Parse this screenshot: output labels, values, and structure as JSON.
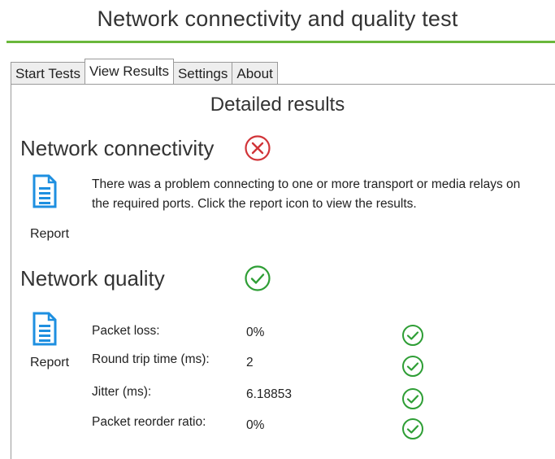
{
  "app": {
    "title": "Network connectivity and quality test"
  },
  "colors": {
    "accent_green": "#6ab83b",
    "error_red": "#d13438",
    "ok_green": "#2e9e35",
    "doc_blue": "#1e8fe0"
  },
  "tabs": [
    {
      "label": "Start Tests",
      "active": false
    },
    {
      "label": "View Results",
      "active": true
    },
    {
      "label": "Settings",
      "active": false
    },
    {
      "label": "About",
      "active": false
    }
  ],
  "results": {
    "heading": "Detailed results",
    "connectivity": {
      "title": "Network connectivity",
      "status_icon": "error-x-circle-icon",
      "report_icon": "document-icon",
      "report_label": "Report",
      "message": "There was a problem connecting to one or more transport or media relays on the required ports. Click the report icon to view the results."
    },
    "quality": {
      "title": "Network quality",
      "status_icon": "check-circle-icon",
      "report_icon": "document-icon",
      "report_label": "Report",
      "metrics": [
        {
          "label": "Packet loss:",
          "value": "0%",
          "status_icon": "check-circle-icon"
        },
        {
          "label": "Round trip time (ms):",
          "value": "2",
          "status_icon": "check-circle-icon"
        },
        {
          "label": "Jitter (ms):",
          "value": "6.18853",
          "status_icon": "check-circle-icon"
        },
        {
          "label": "Packet reorder ratio:",
          "value": "0%",
          "status_icon": "check-circle-icon"
        }
      ]
    }
  }
}
